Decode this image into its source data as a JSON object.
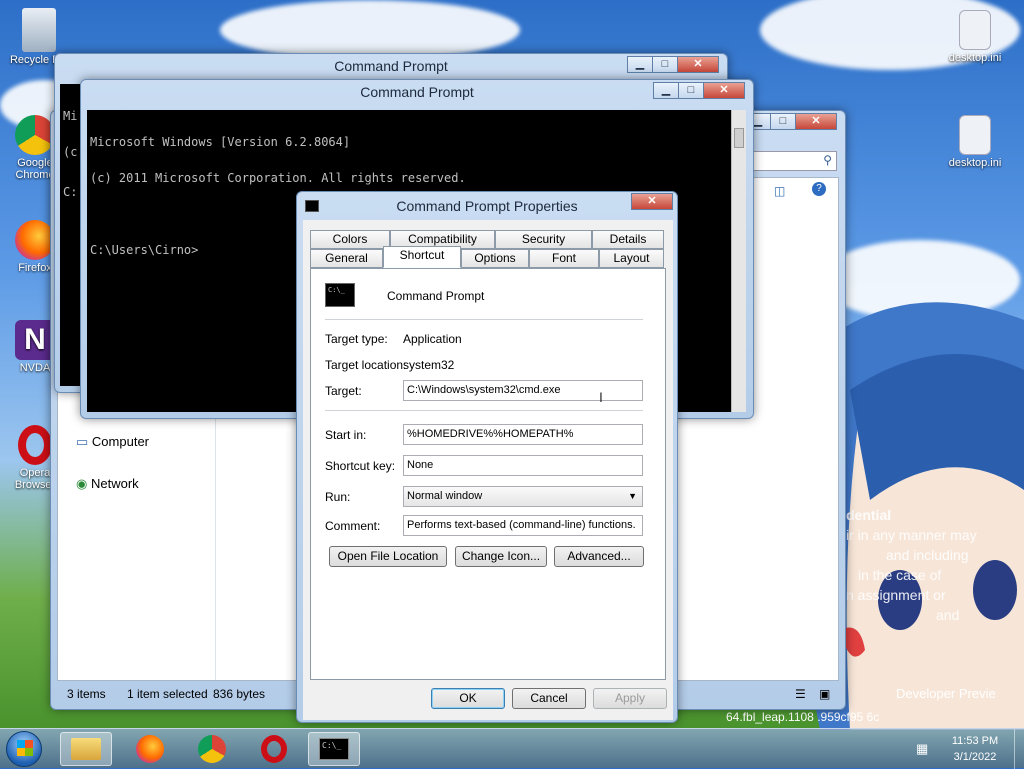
{
  "desktop": {
    "recycle_bin": "Recycle Bin",
    "chrome": "Google Chrome",
    "firefox": "Firefox",
    "nvda": "NVDA",
    "opera": "Opera Browser",
    "ini1": "desktop.ini",
    "ini2": "desktop.ini",
    "watermark": {
      "line1": "dential",
      "line2": "ir in any manner may",
      "line3": "and including",
      "line4": "in the case of",
      "line5": "n assignment or",
      "line6": "and",
      "preview": "Developer Previe",
      "build": "64.fbl_leap.1108 .959cf95 6c"
    }
  },
  "cmd_back": {
    "title": "Command Prompt",
    "line1": "Mi",
    "line2": "(c",
    "line3": "C:"
  },
  "cmd_front": {
    "title": "Command Prompt",
    "lines": [
      "Microsoft Windows [Version 6.2.8064]",
      "(c) 2011 Microsoft Corporation. All rights reserved.",
      "",
      "C:\\Users\\Cirno>"
    ]
  },
  "explorer": {
    "sidebar": [
      "Computer",
      "Network"
    ],
    "status": {
      "items": "3 items",
      "selected": "1 item selected",
      "size": "836 bytes"
    }
  },
  "dialog": {
    "title": "Command Prompt Properties",
    "tabs_top": [
      "Colors",
      "Compatibility",
      "Security",
      "Details"
    ],
    "tabs_bottom": [
      "General",
      "Shortcut",
      "Options",
      "Font",
      "Layout"
    ],
    "app_name": "Command Prompt",
    "target_type_label": "Target type:",
    "target_type": "Application",
    "target_location_label": "Target location:",
    "target_location": "system32",
    "target_label": "Target:",
    "target": "C:\\Windows\\system32\\cmd.exe",
    "start_in_label": "Start in:",
    "start_in": "%HOMEDRIVE%%HOMEPATH%",
    "shortcut_key_label": "Shortcut key:",
    "shortcut_key": "None",
    "run_label": "Run:",
    "run": "Normal window",
    "comment_label": "Comment:",
    "comment": "Performs text-based (command-line) functions.",
    "open_file_location": "Open File Location",
    "change_icon": "Change Icon...",
    "advanced": "Advanced...",
    "ok": "OK",
    "cancel": "Cancel",
    "apply": "Apply"
  },
  "taskbar": {
    "time": "11:53 PM",
    "date": "3/1/2022"
  }
}
